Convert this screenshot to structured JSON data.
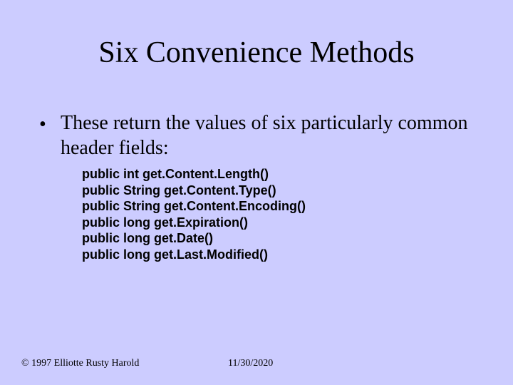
{
  "title": "Six Convenience Methods",
  "bullet": {
    "mark": "•",
    "text": "These return the values of six particularly common header fields:"
  },
  "code": [
    "public int get.Content.Length()",
    "public String get.Content.Type()",
    "public String get.Content.Encoding()",
    "public long get.Expiration()",
    "public long get.Date()",
    "public long get.Last.Modified()"
  ],
  "footer": {
    "copyright": "© 1997 Elliotte Rusty Harold",
    "date": "11/30/2020"
  }
}
